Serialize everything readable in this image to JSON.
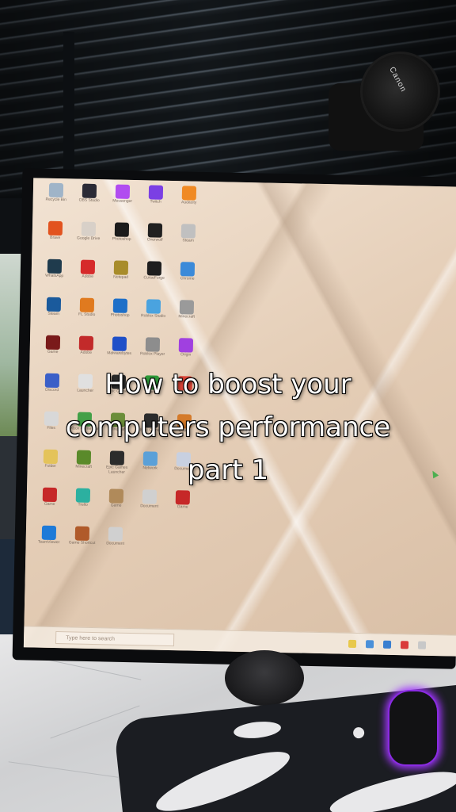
{
  "caption": {
    "line1": "How to boost your",
    "line2": "computers performance",
    "line3": "part 1"
  },
  "camera": {
    "brand": "Canon"
  },
  "desktop": {
    "icons": [
      {
        "label": "Recycle Bin",
        "color": "#9fb4c8"
      },
      {
        "label": "OBS Studio",
        "color": "#2a2a35"
      },
      {
        "label": "Messenger",
        "color": "#b14cf0"
      },
      {
        "label": "Twitch",
        "color": "#7b3fe4"
      },
      {
        "label": "Audacity",
        "color": "#f08a24"
      },
      {
        "label": "Brave",
        "color": "#e2531f"
      },
      {
        "label": "Google Drive",
        "color": "#d8d0c8"
      },
      {
        "label": "Photoshop",
        "color": "#1b1b1b"
      },
      {
        "label": "Overwolf",
        "color": "#202020"
      },
      {
        "label": "Steam",
        "color": "#c0c0c0"
      },
      {
        "label": "WhatsApp",
        "color": "#1f3b4d"
      },
      {
        "label": "Adobe",
        "color": "#d62a2a"
      },
      {
        "label": "Notepad",
        "color": "#a88c2a"
      },
      {
        "label": "CurseForge",
        "color": "#1e1e1e"
      },
      {
        "label": "Chrome",
        "color": "#3b8ad9"
      },
      {
        "label": "Steam",
        "color": "#1a5a9c"
      },
      {
        "label": "FL Studio",
        "color": "#e07a1f"
      },
      {
        "label": "Photoshop",
        "color": "#1e6fc8"
      },
      {
        "label": "Roblox Studio",
        "color": "#4aa3df"
      },
      {
        "label": "Minecraft",
        "color": "#9a9a9a"
      },
      {
        "label": "Game",
        "color": "#7a1a1a"
      },
      {
        "label": "Adobe",
        "color": "#c22a2a"
      },
      {
        "label": "Malwarebytes",
        "color": "#1e4fc8"
      },
      {
        "label": "Roblox Player",
        "color": "#8d8d8d"
      },
      {
        "label": "Origin",
        "color": "#a040e0"
      },
      {
        "label": "Discord",
        "color": "#3a5fc8"
      },
      {
        "label": "Launcher",
        "color": "#e0e0e0"
      },
      {
        "label": "Epic Games",
        "color": "#2a2a2a"
      },
      {
        "label": "Xbox",
        "color": "#2f9a3a"
      },
      {
        "label": "Chrome",
        "color": "#db4437"
      },
      {
        "label": "Files",
        "color": "#d8d8d8"
      },
      {
        "label": "Xbox Game Bar",
        "color": "#43a047"
      },
      {
        "label": "Minecraft",
        "color": "#6b8e3a"
      },
      {
        "label": "Epic Games",
        "color": "#2b2b2b"
      },
      {
        "label": "Game",
        "color": "#d47a2a"
      },
      {
        "label": "Folder",
        "color": "#e4c35a"
      },
      {
        "label": "Minecraft",
        "color": "#5a8a2a"
      },
      {
        "label": "Epic Games Launcher",
        "color": "#2c2c2c"
      },
      {
        "label": "Network",
        "color": "#5aa0d8"
      },
      {
        "label": "Document",
        "color": "#c8d0e0"
      },
      {
        "label": "Game",
        "color": "#c62828"
      },
      {
        "label": "Trello",
        "color": "#2cb0a0"
      },
      {
        "label": "Game",
        "color": "#b08a5a"
      },
      {
        "label": "Document",
        "color": "#d0d0d0"
      },
      {
        "label": "Game",
        "color": "#c62828"
      },
      {
        "label": "TeamViewer",
        "color": "#1e7ad8"
      },
      {
        "label": "Game Shortcut",
        "color": "#b05a2a"
      },
      {
        "label": "Document",
        "color": "#d0d0d0"
      }
    ],
    "taskbar": {
      "search_placeholder": "Type here to search",
      "tray_colors": [
        "#e8c84a",
        "#4a90d9",
        "#3a7fd0",
        "#d93a3a",
        "#c8c8c8"
      ]
    }
  }
}
